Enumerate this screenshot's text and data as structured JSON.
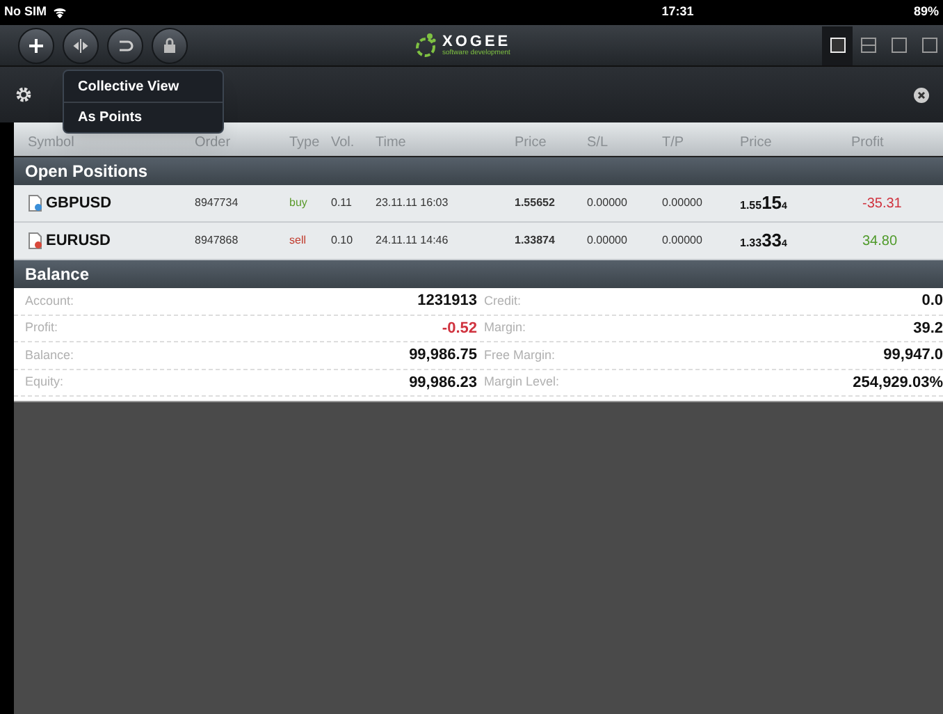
{
  "status_bar": {
    "carrier": "No SIM",
    "time": "17:31",
    "battery": "89%"
  },
  "toolbar": {
    "logo": "XOGEE",
    "logo_subtitle": "software development",
    "view_buttons": [
      {
        "selected": true
      },
      {
        "selected": false
      },
      {
        "selected": false
      },
      {
        "selected": false
      }
    ]
  },
  "popup_menu": {
    "items": [
      {
        "label": "Collective View"
      },
      {
        "label": "As Points"
      }
    ]
  },
  "table": {
    "columns": [
      "Symbol",
      "Order",
      "Type",
      "Vol.",
      "Time",
      "Price",
      "S/L",
      "T/P",
      "Price",
      "Profit"
    ],
    "section": "Open Positions",
    "rows": [
      {
        "symbol": "GBPUSD",
        "color": "#3b8fd9",
        "order": "8947734",
        "type": "buy",
        "kind": "buy",
        "volume": "0.11",
        "time": "23.11.11 16:03",
        "open_price": "1.55652",
        "sl": "0.00000",
        "tp": "0.00000",
        "price_prefix": "1.55",
        "price_pips": "15",
        "price_last": "4",
        "profit": "-35.31",
        "negative": true
      },
      {
        "symbol": "EURUSD",
        "color": "#d9493b",
        "order": "8947868",
        "type": "sell",
        "kind": "sell",
        "volume": "0.10",
        "time": "24.11.11 14:46",
        "open_price": "1.33874",
        "sl": "0.00000",
        "tp": "0.00000",
        "price_prefix": "1.33",
        "price_pips": "33",
        "price_last": "4",
        "profit": "34.80",
        "negative": false
      }
    ]
  },
  "balance": {
    "title": "Balance",
    "rows": [
      {
        "left_label": "Account:",
        "left_value": "1231913",
        "left_negative": false,
        "right_label": "Credit:",
        "right_value": "0.0"
      },
      {
        "left_label": "Profit:",
        "left_value": "-0.52",
        "left_negative": true,
        "right_label": "Margin:",
        "right_value": "39.2"
      },
      {
        "left_label": "Balance:",
        "left_value": "99,986.75",
        "left_negative": false,
        "right_label": "Free Margin:",
        "right_value": "99,947.0"
      },
      {
        "left_label": "Equity:",
        "left_value": "99,986.23",
        "left_negative": false,
        "right_label": "Margin Level:",
        "right_value": "254,929.03%"
      }
    ]
  }
}
